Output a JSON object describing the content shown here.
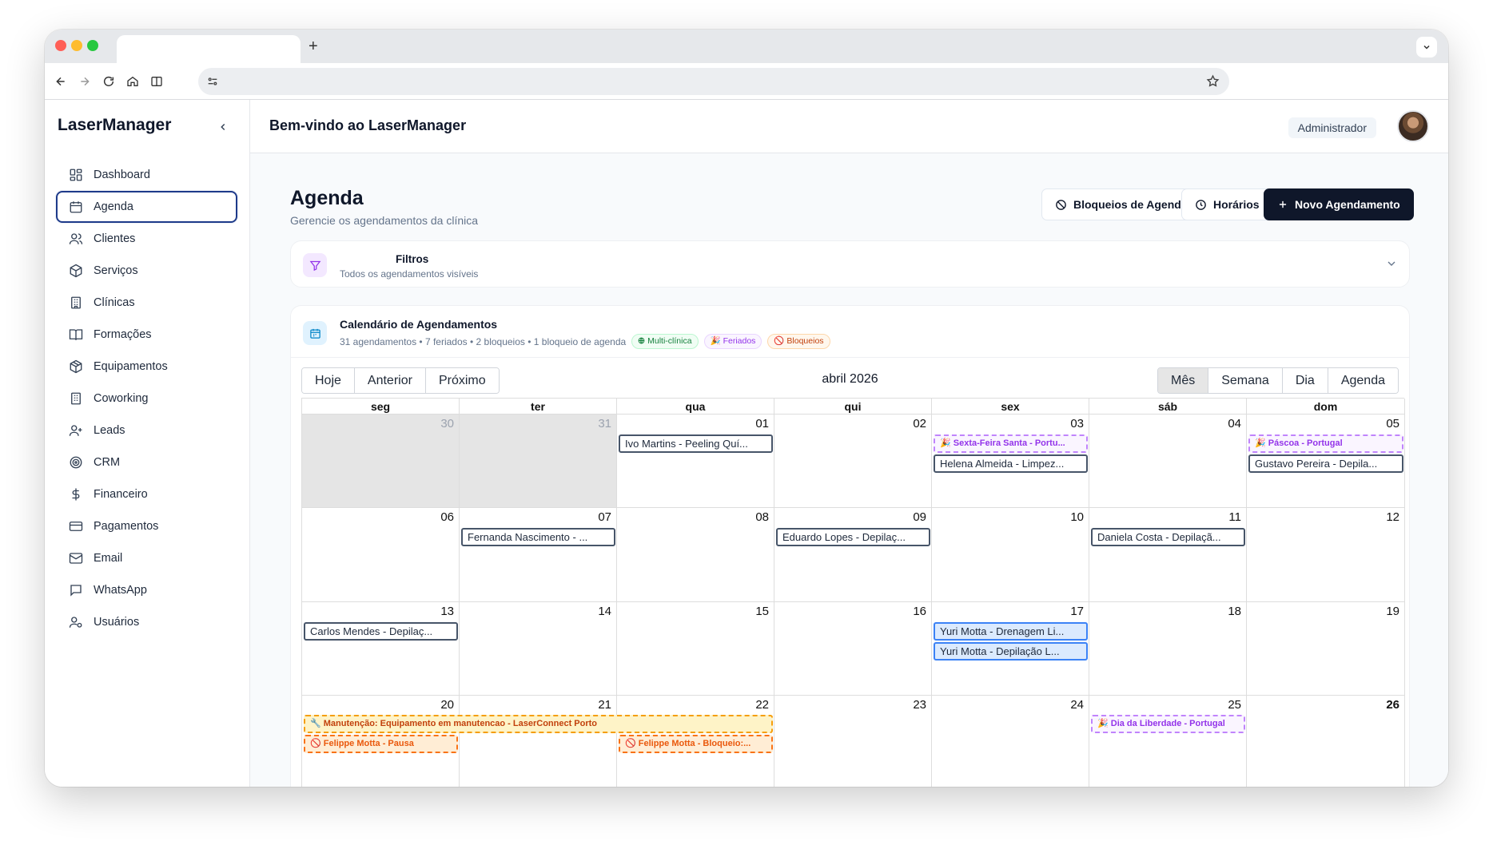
{
  "browser": {
    "new_tab_label": "+"
  },
  "sidebar": {
    "brand": "LaserManager",
    "items": [
      {
        "label": "Dashboard",
        "icon": "dashboard-icon"
      },
      {
        "label": "Agenda",
        "icon": "calendar-icon"
      },
      {
        "label": "Clientes",
        "icon": "users-icon"
      },
      {
        "label": "Serviços",
        "icon": "box-icon"
      },
      {
        "label": "Clínicas",
        "icon": "building-icon"
      },
      {
        "label": "Formações",
        "icon": "book-icon"
      },
      {
        "label": "Equipamentos",
        "icon": "package-icon"
      },
      {
        "label": "Coworking",
        "icon": "office-icon"
      },
      {
        "label": "Leads",
        "icon": "user-plus-icon"
      },
      {
        "label": "CRM",
        "icon": "target-icon"
      },
      {
        "label": "Financeiro",
        "icon": "dollar-icon"
      },
      {
        "label": "Pagamentos",
        "icon": "credit-card-icon"
      },
      {
        "label": "Email",
        "icon": "mail-icon"
      },
      {
        "label": "WhatsApp",
        "icon": "chat-icon"
      },
      {
        "label": "Usuários",
        "icon": "user-cog-icon"
      }
    ],
    "active_index": 1
  },
  "header": {
    "welcome": "Bem-vindo ao LaserManager",
    "role": "Administrador"
  },
  "page": {
    "title": "Agenda",
    "subtitle": "Gerencie os agendamentos da clínica",
    "actions": {
      "blocks": "Bloqueios de Agenda",
      "hours": "Horários",
      "new": "Novo Agendamento"
    }
  },
  "filters": {
    "title": "Filtros",
    "subtitle": "Todos os agendamentos visíveis"
  },
  "calendar": {
    "title": "Calendário de Agendamentos",
    "summary": "31 agendamentos • 7 feriados • 2 bloqueios • 1 bloqueio de agenda",
    "badges": [
      "Multi-clínica",
      "🎉 Feriados",
      "🚫 Bloqueios"
    ],
    "nav_buttons": [
      "Hoje",
      "Anterior",
      "Próximo"
    ],
    "view_buttons": [
      "Mês",
      "Semana",
      "Dia",
      "Agenda"
    ],
    "active_view": "Mês",
    "month_label": "abril 2026",
    "weekdays": [
      "seg",
      "ter",
      "qua",
      "qui",
      "sex",
      "sáb",
      "dom"
    ],
    "weeks": [
      [
        "30",
        "31",
        "01",
        "02",
        "03",
        "04",
        "05"
      ],
      [
        "06",
        "07",
        "08",
        "09",
        "10",
        "11",
        "12"
      ],
      [
        "13",
        "14",
        "15",
        "16",
        "17",
        "18",
        "19"
      ],
      [
        "20",
        "21",
        "22",
        "23",
        "24",
        "25",
        "26"
      ]
    ],
    "events": {
      "w0_wed": "Ivo Martins - Peeling Quí...",
      "w0_fri_holiday": "🎉 Sexta-Feira Santa - Portu...",
      "w0_fri": "Helena Almeida - Limpez...",
      "w0_sun_holiday": "🎉 Páscoa - Portugal",
      "w0_sun": "Gustavo Pereira - Depila...",
      "w1_tue": "Fernanda Nascimento - ...",
      "w1_thu": "Eduardo Lopes - Depilaç...",
      "w1_sat": "Daniela Costa - Depilaçã...",
      "w2_mon": "Carlos Mendes - Depilaç...",
      "w2_fri_1": "Yuri Motta - Drenagem Li...",
      "w2_fri_2": "Yuri Motta - Depilação L...",
      "w3_maint": "🔧 Manutenção: Equipamento em manutencao - LaserConnect Porto",
      "w3_block_1": "🚫 Felippe Motta - Pausa",
      "w3_block_2": "🚫 Felippe Motta - Bloqueio:...",
      "w3_sat_holiday": "🎉 Dia da Liberdade - Portugal"
    }
  }
}
